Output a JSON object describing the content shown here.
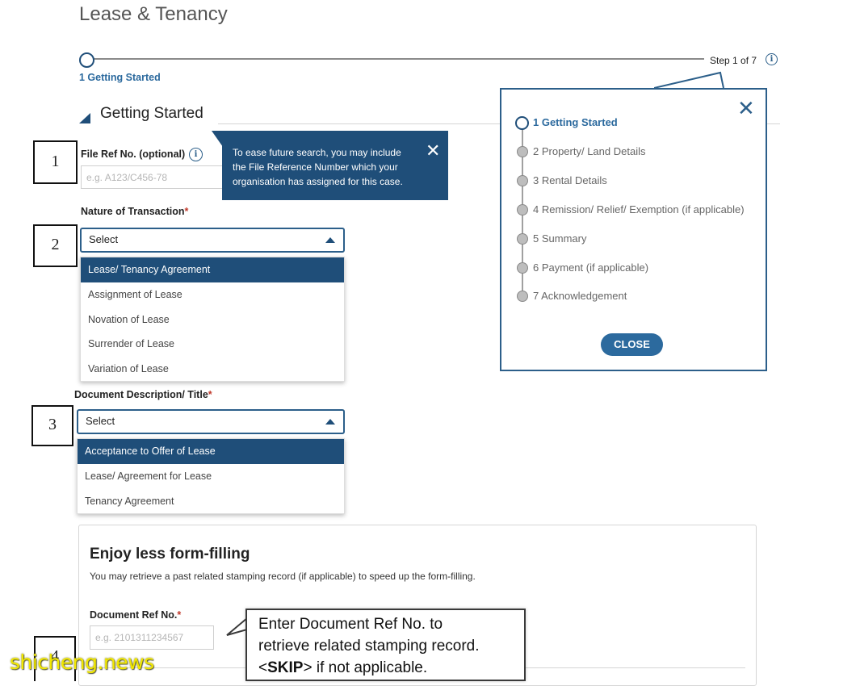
{
  "page": {
    "title": "Lease & Tenancy"
  },
  "progress": {
    "current_label": "1 Getting Started",
    "step_count": "Step 1 of 7"
  },
  "section": {
    "title": "Getting Started"
  },
  "annotations": {
    "box1": "1",
    "box2": "2",
    "box3": "3",
    "box4": "4"
  },
  "file_ref": {
    "label": "File Ref No. (optional)",
    "placeholder": "e.g. A123/C456-78",
    "tooltip": "To ease future search, you may include the File Reference Number which your organisation has assigned for this case."
  },
  "nature_of_transaction": {
    "label": "Nature of Transaction",
    "required_mark": "*",
    "value": "Select",
    "options": [
      "Lease/ Tenancy Agreement",
      "Assignment of Lease",
      "Novation of Lease",
      "Surrender of Lease",
      "Variation of Lease"
    ],
    "highlighted_index": 0
  },
  "document_description": {
    "label": "Document Description/ Title",
    "required_mark": "*",
    "value": "Select",
    "options": [
      "Acceptance to Offer of Lease",
      "Lease/ Agreement for Lease",
      "Tenancy Agreement"
    ],
    "highlighted_index": 0
  },
  "steps_panel": {
    "steps": [
      "1 Getting Started",
      "2 Property/ Land Details",
      "3 Rental Details",
      "4 Remission/ Relief/ Exemption (if applicable)",
      "5 Summary",
      "6 Payment (if applicable)",
      "7 Acknowledgement"
    ],
    "active_index": 0,
    "close_label": "CLOSE"
  },
  "retrieve_card": {
    "title": "Enjoy less form-filling",
    "subtitle": "You may retrieve a past related stamping record (if applicable) to speed up the form-filling.",
    "doc_ref_label": "Document Ref No.",
    "required_mark": "*",
    "doc_ref_placeholder": "e.g. 2101311234567"
  },
  "callout": {
    "line1": "Enter Document Ref No. to",
    "line2": "retrieve related stamping record.",
    "line3_pre": "<",
    "line3_bold": "SKIP",
    "line3_post": "> if not applicable."
  },
  "watermark": {
    "text": "shicheng.news"
  },
  "colors": {
    "primary": "#1f4e79",
    "accent": "#2c6a9e",
    "required": "#c0392b",
    "watermark": "#f2e800"
  },
  "icons": {
    "info": "info-circle-icon",
    "close": "close-x-icon",
    "collapse_arrow": "chevron-up-icon",
    "section_marker": "triangle-marker-icon"
  }
}
